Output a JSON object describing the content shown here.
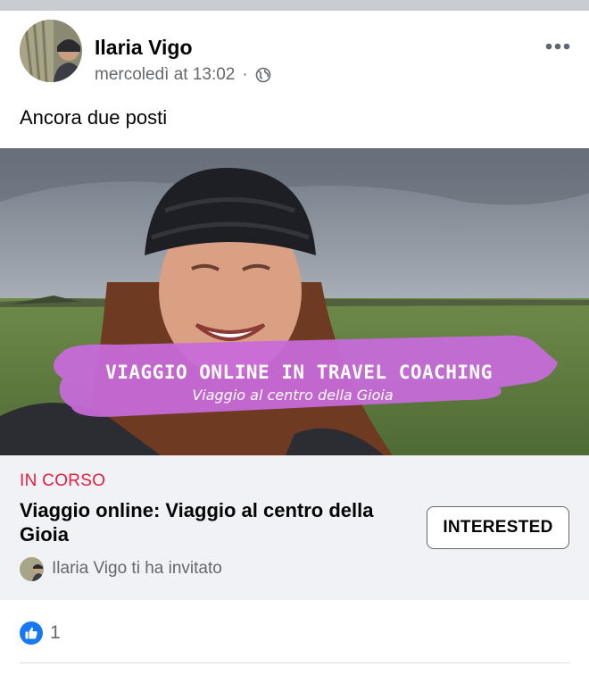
{
  "post": {
    "author": "Ilaria Vigo",
    "timestamp": "mercoledì at 13:02",
    "separator": "·",
    "privacy_icon": "globe-icon",
    "more_icon": "more-options-icon",
    "text": "Ancora due posti"
  },
  "cover": {
    "banner_title": "VIAGGIO ONLINE IN TRAVEL COACHING",
    "banner_subtitle": "Viaggio al centro della Gioia"
  },
  "event": {
    "status": "IN CORSO",
    "title": "Viaggio online: Viaggio al centro della Gioia",
    "interested_label": "INTERESTED",
    "invite_text": "Ilaria Vigo ti ha invitato"
  },
  "reactions": {
    "icon": "like-icon",
    "count": "1"
  },
  "colors": {
    "status_red": "#e41e3f",
    "like_blue": "#1877f2",
    "banner_purple": "#c86bdc",
    "secondary_text": "#65676b"
  }
}
